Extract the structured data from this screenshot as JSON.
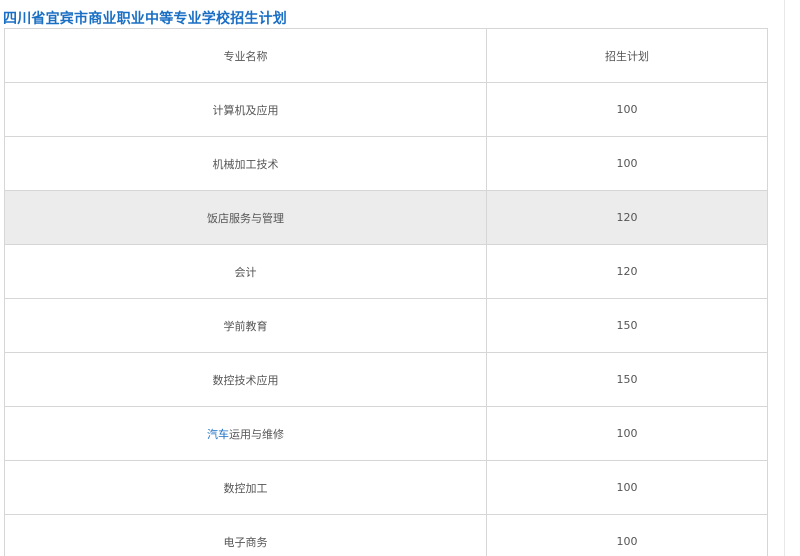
{
  "title": "四川省宜宾市商业职业中等专业学校招生计划",
  "table": {
    "headers": [
      "专业名称",
      "招生计划"
    ],
    "rows": [
      {
        "name": "计算机及应用",
        "plan": "100"
      },
      {
        "name": "机械加工技术",
        "plan": "100"
      },
      {
        "name": "饭店服务与管理",
        "plan": "120"
      },
      {
        "name": "会计",
        "plan": "120"
      },
      {
        "name": "学前教育",
        "plan": "150"
      },
      {
        "name": "数控技术应用",
        "plan": "150"
      },
      {
        "name_link": "汽车",
        "name_rest": "运用与维修",
        "plan": "100"
      },
      {
        "name": "数控加工",
        "plan": "100"
      },
      {
        "name": "电子商务",
        "plan": "100"
      }
    ]
  },
  "colors": {
    "title": "#1a6fc4",
    "link": "#1a6fc4",
    "border": "#d6d6d6",
    "highlight_row": "#ececec",
    "text": "#555555"
  }
}
